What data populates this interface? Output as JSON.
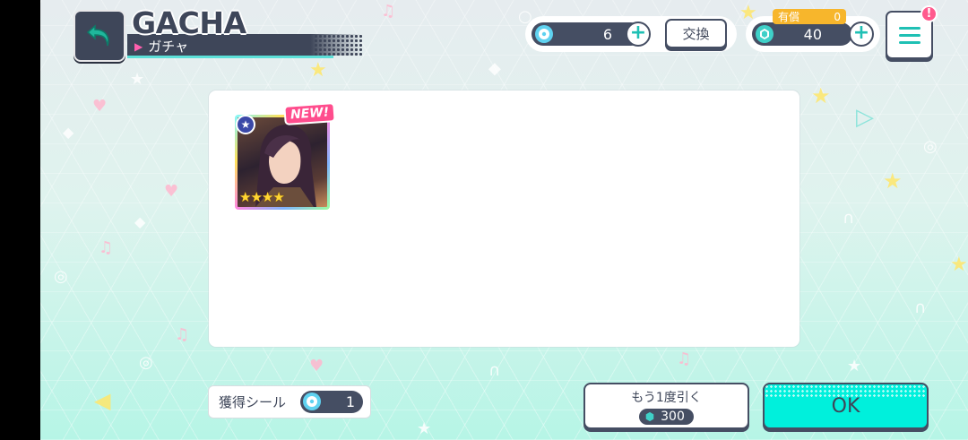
{
  "header": {
    "title": "GACHA",
    "subtitle": "ガチャ"
  },
  "currency": {
    "tickets": {
      "icon": "ticket-disc-icon",
      "value": "6"
    },
    "exchange_label": "交換",
    "crystals": {
      "icon": "crystal-icon",
      "value": "40"
    },
    "paid": {
      "label": "有償",
      "value": "0"
    }
  },
  "menu": {
    "badge": "!"
  },
  "result": {
    "cards": [
      {
        "tag": "NEW!",
        "rarity_stars": 4,
        "stars": "★★★★",
        "attribute_icon": "star-attribute-icon"
      }
    ]
  },
  "footer": {
    "stickers_label": "獲得シール",
    "stickers_value": "1",
    "draw_again_label": "もう1度引く",
    "draw_again_cost": "300",
    "ok_label": "OK"
  },
  "colors": {
    "navy": "#3e4659",
    "teal": "#00f0dc",
    "pink": "#ff5a8d",
    "gold": "#f7b62c"
  }
}
